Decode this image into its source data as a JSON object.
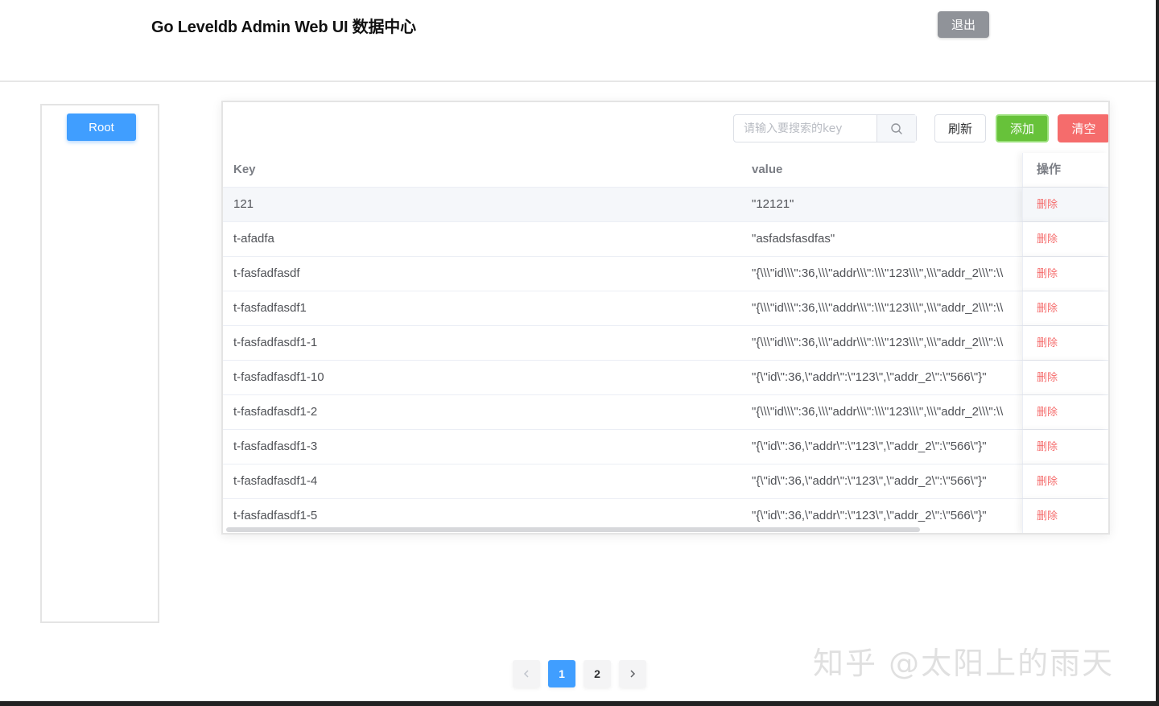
{
  "header": {
    "title": "Go Leveldb Admin Web UI 数据中心",
    "logout_label": "退出"
  },
  "sidebar": {
    "root_label": "Root"
  },
  "toolbar": {
    "search_placeholder": "请输入要搜索的key",
    "search_icon": "search-icon",
    "refresh_label": "刷新",
    "add_label": "添加",
    "clear_label": "清空"
  },
  "table": {
    "columns": [
      "Key",
      "value",
      "操作"
    ],
    "delete_label": "删除",
    "rows": [
      {
        "key": "121",
        "value": "\"12121\""
      },
      {
        "key": "t-afadfa",
        "value": "\"asfadsfasdfas\""
      },
      {
        "key": "t-fasfadfasdf",
        "value": "\"{\\\\\\\"id\\\\\\\":36,\\\\\\\"addr\\\\\\\":\\\\\\\"123\\\\\\\",\\\\\\\"addr_2\\\\\\\":\\\\"
      },
      {
        "key": "t-fasfadfasdf1",
        "value": "\"{\\\\\\\"id\\\\\\\":36,\\\\\\\"addr\\\\\\\":\\\\\\\"123\\\\\\\",\\\\\\\"addr_2\\\\\\\":\\\\"
      },
      {
        "key": "t-fasfadfasdf1-1",
        "value": "\"{\\\\\\\"id\\\\\\\":36,\\\\\\\"addr\\\\\\\":\\\\\\\"123\\\\\\\",\\\\\\\"addr_2\\\\\\\":\\\\"
      },
      {
        "key": "t-fasfadfasdf1-10",
        "value": "\"{\\\"id\\\":36,\\\"addr\\\":\\\"123\\\",\\\"addr_2\\\":\\\"566\\\"}\""
      },
      {
        "key": "t-fasfadfasdf1-2",
        "value": "\"{\\\\\\\"id\\\\\\\":36,\\\\\\\"addr\\\\\\\":\\\\\\\"123\\\\\\\",\\\\\\\"addr_2\\\\\\\":\\\\"
      },
      {
        "key": "t-fasfadfasdf1-3",
        "value": "\"{\\\"id\\\":36,\\\"addr\\\":\\\"123\\\",\\\"addr_2\\\":\\\"566\\\"}\""
      },
      {
        "key": "t-fasfadfasdf1-4",
        "value": "\"{\\\"id\\\":36,\\\"addr\\\":\\\"123\\\",\\\"addr_2\\\":\\\"566\\\"}\""
      },
      {
        "key": "t-fasfadfasdf1-5",
        "value": "\"{\\\"id\\\":36,\\\"addr\\\":\\\"123\\\",\\\"addr_2\\\":\\\"566\\\"}\""
      }
    ]
  },
  "pagination": {
    "pages": [
      "1",
      "2"
    ],
    "current": "1"
  },
  "watermark": "知乎 @太阳上的雨天",
  "colors": {
    "primary": "#409eff",
    "success": "#67c23a",
    "danger": "#f56c6c",
    "info": "#909399"
  }
}
